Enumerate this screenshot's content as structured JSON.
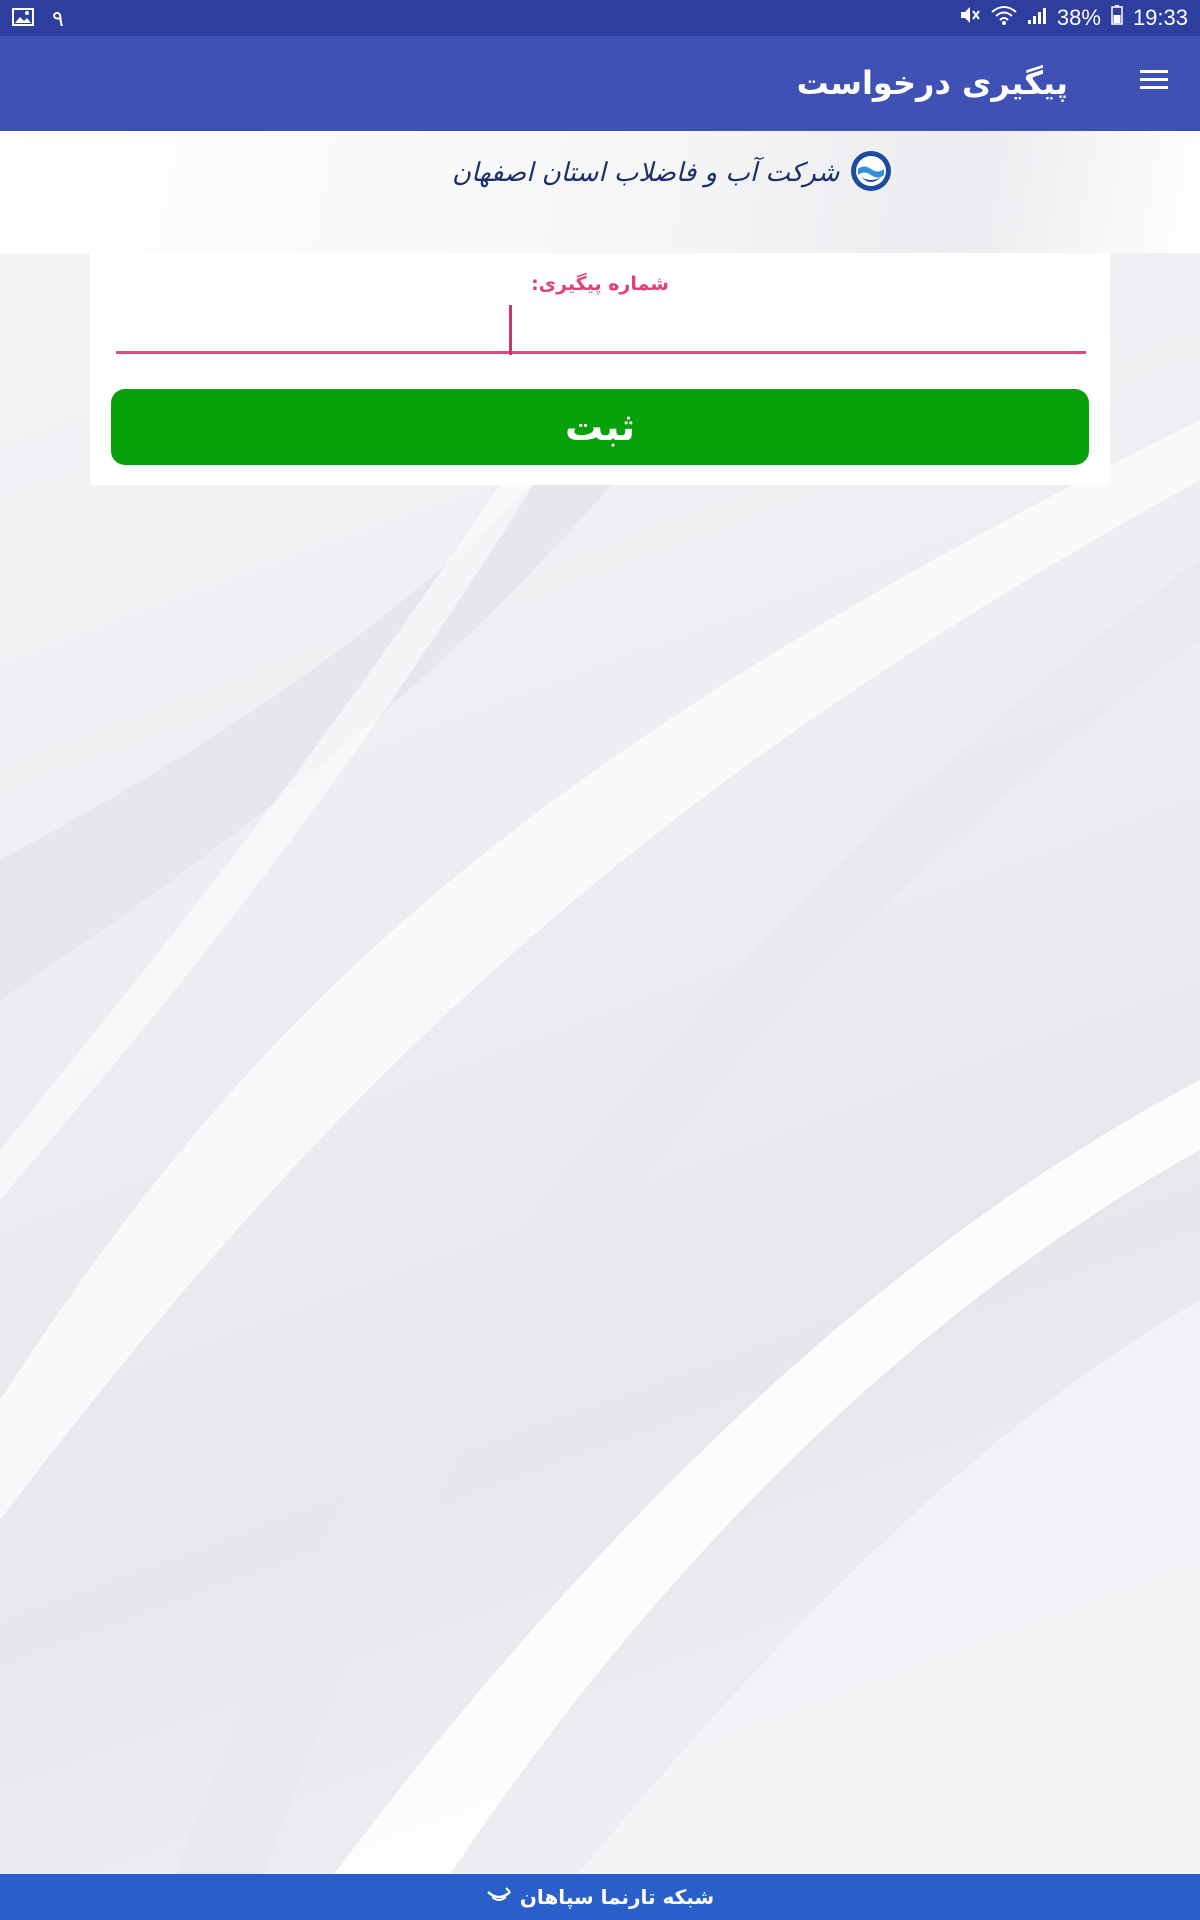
{
  "status_bar": {
    "notification_count": "۹",
    "battery": "38%",
    "time": "19:33",
    "icons": [
      "image-notification-icon",
      "mute-icon",
      "wifi-icon",
      "signal-icon",
      "battery-icon"
    ]
  },
  "app_bar": {
    "title": "پیگیری درخواست",
    "menu_icon": "hamburger-menu-icon",
    "background": "#3f51b5"
  },
  "logo": {
    "text": "شرکت آب و فاضلاب استان اصفهان",
    "icon": "water-company-logo-icon"
  },
  "form": {
    "label": "شماره پیگیری:",
    "input_value": "",
    "submit_label": "ثبت",
    "submit_color": "#08a10c",
    "accent_color": "#e0417a"
  },
  "footer": {
    "text": "شبکه تارنما سپاهان",
    "icon": "tarnama-logo-icon",
    "background": "#2a5fca"
  }
}
